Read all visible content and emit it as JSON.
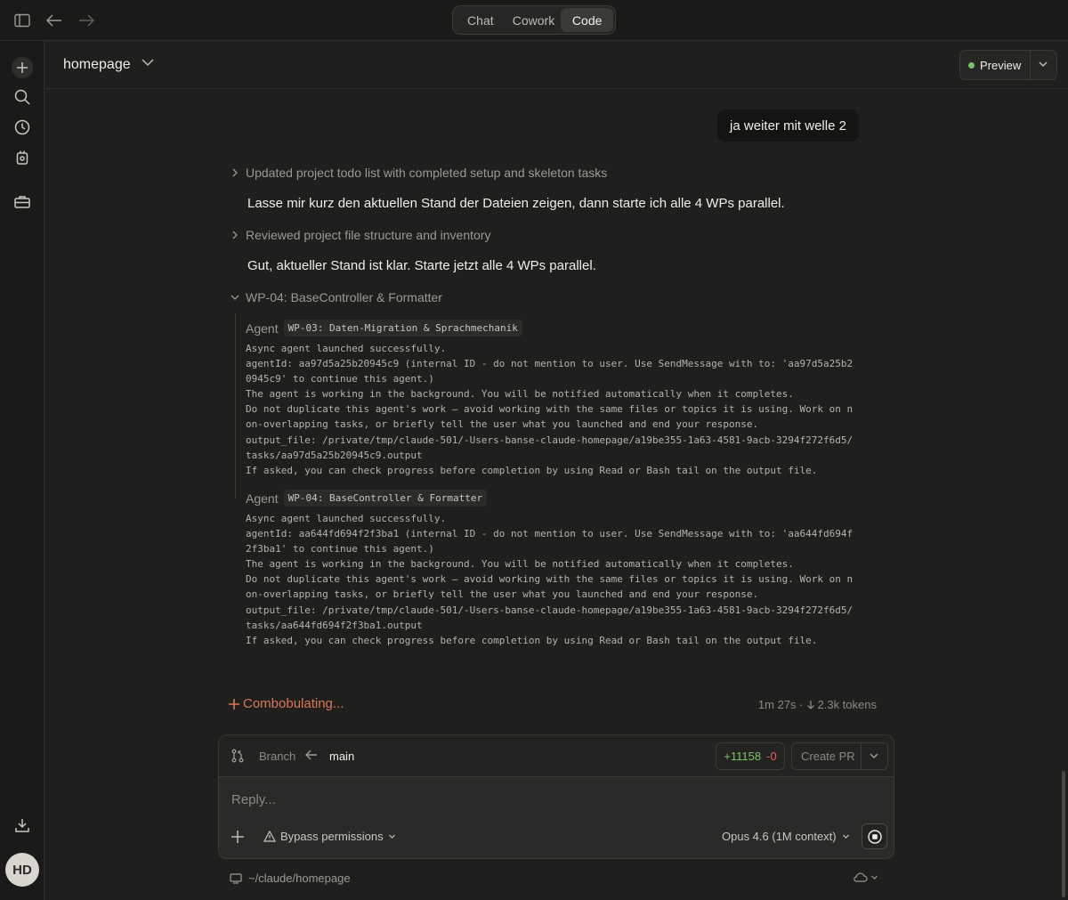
{
  "topbar": {
    "modes": [
      "Chat",
      "Cowork",
      "Code"
    ],
    "active_mode": "Code"
  },
  "sidebar": {
    "items": [
      {
        "icon": "plus-icon"
      },
      {
        "icon": "search-icon"
      },
      {
        "icon": "clock-icon"
      },
      {
        "icon": "agent-icon"
      },
      {
        "icon": "toolbox-icon"
      }
    ],
    "download_icon": "download-icon",
    "avatar_initials": "HD"
  },
  "header": {
    "project": "homepage",
    "preview_label": "Preview",
    "preview_status_color": "#7ec36b"
  },
  "conversation": {
    "user_message": "ja weiter mit welle 2",
    "steps": [
      {
        "label": "Updated project todo list with completed setup and skeleton tasks",
        "expanded": false
      },
      {
        "text": "Lasse mir kurz den aktuellen Stand der Dateien zeigen, dann starte ich alle 4 WPs parallel."
      },
      {
        "label": "Reviewed project file structure and inventory",
        "expanded": false
      },
      {
        "text": "Gut, aktueller Stand ist klar. Starte jetzt alle 4 WPs parallel."
      },
      {
        "label": "WP-04: BaseController & Formatter",
        "expanded": true
      }
    ],
    "agents": [
      {
        "label": "Agent",
        "task": "WP-03: Daten-Migration & Sprachmechanik",
        "output": "Async agent launched successfully.\nagentId: aa97d5a25b20945c9 (internal ID - do not mention to user. Use SendMessage with to: 'aa97d5a25b2\n0945c9' to continue this agent.)\nThe agent is working in the background. You will be notified automatically when it completes.\nDo not duplicate this agent's work — avoid working with the same files or topics it is using. Work on n\non-overlapping tasks, or briefly tell the user what you launched and end your response.\noutput_file: /private/tmp/claude-501/-Users-banse-claude-homepage/a19be355-1a63-4581-9acb-3294f272f6d5/\ntasks/aa97d5a25b20945c9.output\nIf asked, you can check progress before completion by using Read or Bash tail on the output file."
      },
      {
        "label": "Agent",
        "task": "WP-04: BaseController & Formatter",
        "output": "Async agent launched successfully.\nagentId: aa644fd694f2f3ba1 (internal ID - do not mention to user. Use SendMessage with to: 'aa644fd694f\n2f3ba1' to continue this agent.)\nThe agent is working in the background. You will be notified automatically when it completes.\nDo not duplicate this agent's work — avoid working with the same files or topics it is using. Work on n\non-overlapping tasks, or briefly tell the user what you launched and end your response.\noutput_file: /private/tmp/claude-501/-Users-banse-claude-homepage/a19be355-1a63-4581-9acb-3294f272f6d5/\ntasks/aa644fd694f2f3ba1.output\nIf asked, you can check progress before completion by using Read or Bash tail on the output file."
      }
    ],
    "status": {
      "label": "Combobulating...",
      "elapsed": "1m 27s ·",
      "tokens": "2.3k tokens",
      "accent": "#d97757"
    }
  },
  "branch_bar": {
    "label": "Branch",
    "branch": "main",
    "additions": "+11158",
    "deletions": "-0",
    "create_pr": "Create PR"
  },
  "composer": {
    "placeholder": "Reply...",
    "permissions": "Bypass permissions",
    "model": "Opus 4.6 (1M context)"
  },
  "footer": {
    "path": "~/claude/homepage"
  }
}
